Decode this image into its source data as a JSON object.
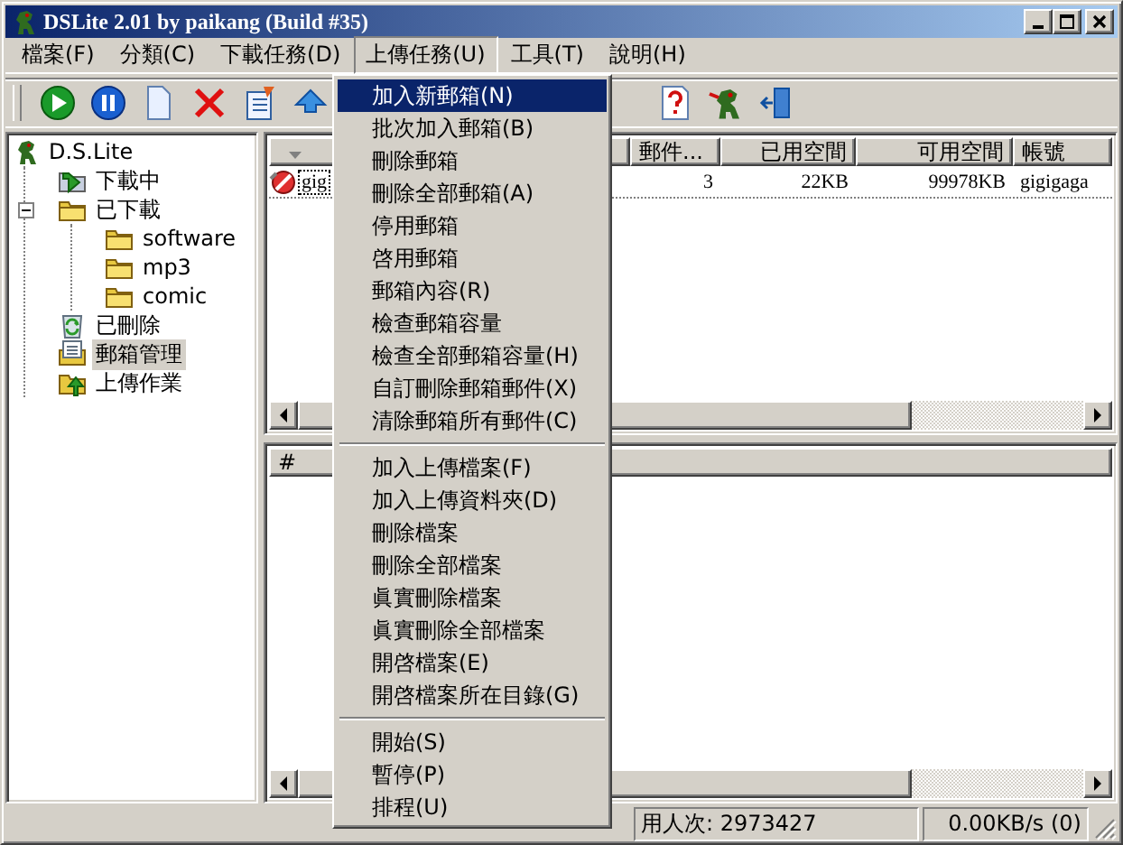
{
  "window": {
    "title": "DSLite 2.01 by paikang (Build #35)"
  },
  "menu_bar": [
    {
      "label": "檔案(F)",
      "selected": false
    },
    {
      "label": "分類(C)",
      "selected": false
    },
    {
      "label": "下載任務(D)",
      "selected": false
    },
    {
      "label": "上傳任務(U)",
      "selected": true
    },
    {
      "label": "工具(T)",
      "selected": false
    },
    {
      "label": "說明(H)",
      "selected": false
    }
  ],
  "tree": {
    "label": "D.S.Lite",
    "kind": "root",
    "selected": false,
    "children": [
      {
        "label": "下載中",
        "kind": "downloading",
        "selected": false
      },
      {
        "label": "已下載",
        "kind": "folder",
        "selected": false,
        "expanded": true,
        "children": [
          {
            "label": "software",
            "kind": "folder",
            "selected": false
          },
          {
            "label": "mp3",
            "kind": "folder",
            "selected": false
          },
          {
            "label": "comic",
            "kind": "folder",
            "selected": false
          }
        ]
      },
      {
        "label": "已刪除",
        "kind": "trash",
        "selected": false
      },
      {
        "label": "郵箱管理",
        "kind": "mailbox",
        "selected": true
      },
      {
        "label": "上傳作業",
        "kind": "upload",
        "selected": false
      }
    ]
  },
  "mailbox_list": {
    "columns": [
      "",
      "郵件...",
      "已用空間",
      "可用空間",
      "帳號"
    ],
    "rows": [
      {
        "cells": [
          "gig",
          "3",
          "22KB",
          "99978KB",
          "gigigaga"
        ]
      }
    ]
  },
  "file_list": {
    "columns": [
      "#"
    ]
  },
  "status_bar": [
    "用人次: 2973427",
    "0.00KB/s (0)"
  ],
  "popup_menu": {
    "groups": [
      [
        {
          "label": "加入新郵箱(N)",
          "selected": true
        },
        {
          "label": "批次加入郵箱(B)",
          "selected": false
        },
        {
          "label": "刪除郵箱",
          "selected": false
        },
        {
          "label": "刪除全部郵箱(A)",
          "selected": false
        },
        {
          "label": "停用郵箱",
          "selected": false
        },
        {
          "label": "啓用郵箱",
          "selected": false
        },
        {
          "label": "郵箱內容(R)",
          "selected": false
        },
        {
          "label": "檢查郵箱容量",
          "selected": false
        },
        {
          "label": "檢查全部郵箱容量(H)",
          "selected": false
        },
        {
          "label": "自訂刪除郵箱郵件(X)",
          "selected": false
        },
        {
          "label": "清除郵箱所有郵件(C)",
          "selected": false
        }
      ],
      [
        {
          "label": "加入上傳檔案(F)",
          "selected": false
        },
        {
          "label": "加入上傳資料夾(D)",
          "selected": false
        },
        {
          "label": "刪除檔案",
          "selected": false
        },
        {
          "label": "刪除全部檔案",
          "selected": false
        },
        {
          "label": "眞實刪除檔案",
          "selected": false
        },
        {
          "label": "眞實刪除全部檔案",
          "selected": false
        },
        {
          "label": "開啓檔案(E)",
          "selected": false
        },
        {
          "label": "開啓檔案所在目錄(G)",
          "selected": false
        }
      ],
      [
        {
          "label": "開始(S)",
          "selected": false
        },
        {
          "label": "暫停(P)",
          "selected": false
        },
        {
          "label": "排程(U)",
          "selected": false
        }
      ]
    ]
  }
}
